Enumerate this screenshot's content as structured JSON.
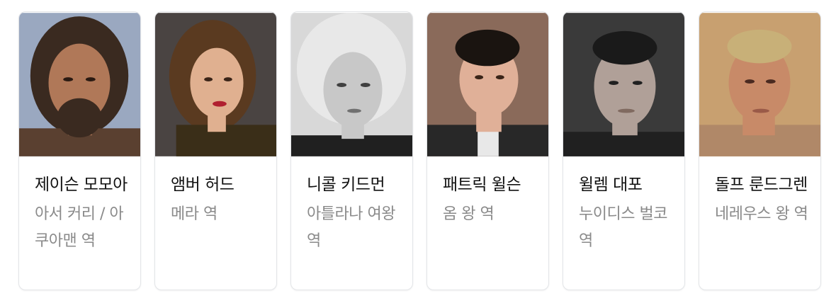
{
  "cast": [
    {
      "name": "제이슨 모모아",
      "role": "아서 커리 / 아쿠아맨 역"
    },
    {
      "name": "앰버 허드",
      "role": "메라 역"
    },
    {
      "name": "니콜 키드먼",
      "role": "아틀라나 여왕 역"
    },
    {
      "name": "패트릭 윌슨",
      "role": "옴 왕 역"
    },
    {
      "name": "윌렘 대포",
      "role": "누이디스 벌코 역"
    },
    {
      "name": "돌프 룬드그렌",
      "role": "네레우스 왕 역"
    }
  ],
  "photo_colors": {
    "bg": [
      "#9aa8c0",
      "#4a4442",
      "#d8d8d8",
      "#8a6a5a",
      "#3a3a3a",
      "#c8a070"
    ],
    "skin": [
      "#b07858",
      "#e0b090",
      "#c8c8c8",
      "#e0b098",
      "#b0a098",
      "#c88a68"
    ],
    "hair": [
      "#3a2a20",
      "#5a3a20",
      "#e8e8e8",
      "#1a1410",
      "#1a1a1a",
      "#c8b078"
    ],
    "cloth": [
      "#5a4030",
      "#3a2e18",
      "#202020",
      "#282828",
      "#202020",
      "#b08868"
    ]
  }
}
